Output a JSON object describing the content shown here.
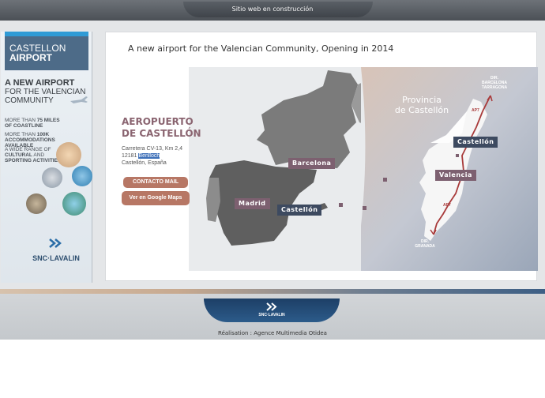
{
  "top": {
    "label": "Sitio web en construcción"
  },
  "banner": {
    "logo_line1": "CASTELLON",
    "logo_line2": "AIRPORT",
    "headline1": "A NEW AIRPORT",
    "headline2": "FOR THE VALENCIAN",
    "headline3": "COMMUNITY",
    "fact1_a": "MORE THAN ",
    "fact1_b": "75 MILES",
    "fact1_c": "OF COASTLINE",
    "fact2_a": "MORE THAN ",
    "fact2_b": "100K ACCOMMODATIONS",
    "fact2_c": "AVAILABLE",
    "fact3_a": "A WIDE RANGE OF",
    "fact3_b": "CULTURAL",
    "fact3_c": " AND",
    "fact3_d": "SPORTING ACTIVITIES",
    "brand": "SNC·LAVALIN"
  },
  "main": {
    "title": "A new airport for the Valencian Community, Opening in 2014",
    "aero_line1": "AEROPUERTO",
    "aero_line2": "DE CASTELLÓN",
    "addr1": "Carretera CV-13, Km 2,4",
    "addr2_a": "12181 ",
    "addr2_b": "Benlloch",
    "addr3": "Castellón, España",
    "btn_mail": "CONTACTO MAIL",
    "btn_maps": "Ver en Google Maps"
  },
  "map": {
    "barcelona": "Barcelona",
    "madrid": "Madrid",
    "castellon_small": "Castellón",
    "provincia1": "Provincia",
    "provincia2": "de Castellón",
    "castellon_big": "Castellón",
    "valencia": "Valencia",
    "dir_north1": "DIR.",
    "dir_north2": "BARCELONA",
    "dir_north3": "TARRAGONA",
    "ap7_top": "AP7",
    "ap7_bottom": "AP7",
    "dir_south1": "DIR.",
    "dir_south2": "GRANADA"
  },
  "footer": {
    "brand": "SNC·LAVALIN",
    "credit": "Réalisation : Agence Multimedia Otidea"
  },
  "colors": {
    "accent": "#b77765",
    "tag": "#7d6070",
    "navy": "#1d3f66"
  }
}
